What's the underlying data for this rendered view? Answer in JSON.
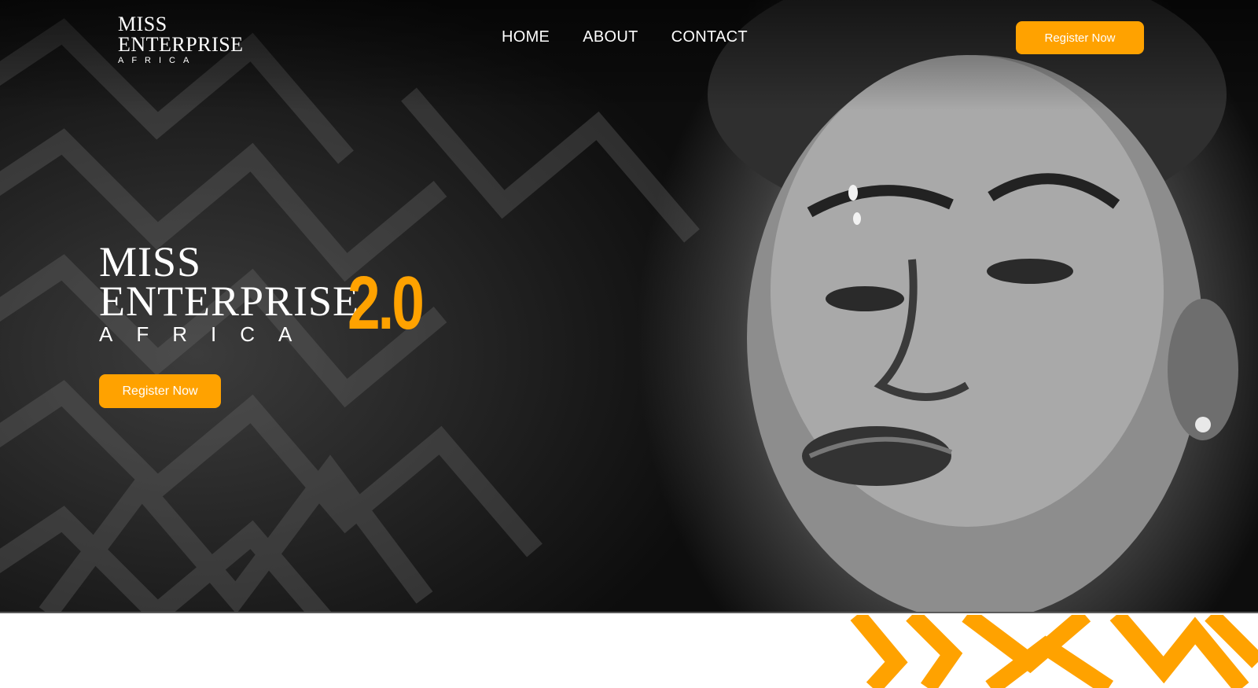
{
  "header": {
    "logo": {
      "line1": "MISS",
      "line2": "ENTERPRISE",
      "line3": "AFRICA"
    },
    "nav": [
      {
        "label": "HOME"
      },
      {
        "label": "ABOUT"
      },
      {
        "label": "CONTACT"
      }
    ],
    "cta_label": "Register Now"
  },
  "hero": {
    "title": {
      "line1": "MISS",
      "line2": "ENTERPRISE",
      "line3": "AFRICA"
    },
    "version": "2.0",
    "cta_label": "Register Now"
  },
  "colors": {
    "accent": "#ffa200",
    "hero_background": "#0d0d0d",
    "text": "#ffffff"
  },
  "images": {
    "hero_photo": "portrait-photo",
    "hero_pattern": "zigzag-pattern",
    "section_pattern": "orange-zigzag-pattern"
  }
}
